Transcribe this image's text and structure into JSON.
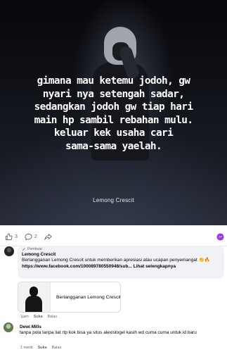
{
  "post": {
    "image_lines": [
      "gimana mau ketemu jodoh, gw",
      "nyari nya setengah sadar,",
      "sedangkan jodoh gw tiap hari",
      "main hp sambil rebahan mulu.",
      "keluar kek usaha cari",
      "sama-sama yaelah."
    ],
    "image_caption": "Lemong Crescit"
  },
  "actions": {
    "like_count": "3",
    "comment_count": "2"
  },
  "comments": [
    {
      "badge": "Pembuat",
      "author": "Lemong Crescit",
      "text_before": "Berlangganan Lemong Crescit untuk memberikan apresiasi atau ucapan penyemangat 👏🔥 ",
      "link": "https://www.facebook.com/100089780550948/sub...",
      "more": "Lihat selengkapnya",
      "card_title": "Berlangganan Lemong Crescit",
      "time": "1jam",
      "like_label": "Suka",
      "reply_label": "Balas"
    },
    {
      "author": "Dewi Mills",
      "text": "tanpa pola tanpa liat rtp kok bisa ya situs alexistogel kasih wd cuma cuma untuk id baru",
      "time": "1 menit",
      "like_label": "Suka",
      "reply_label": "Balas"
    }
  ],
  "colors": {
    "comment_bg": "#f0f2f5",
    "meta_text": "#65676b"
  }
}
